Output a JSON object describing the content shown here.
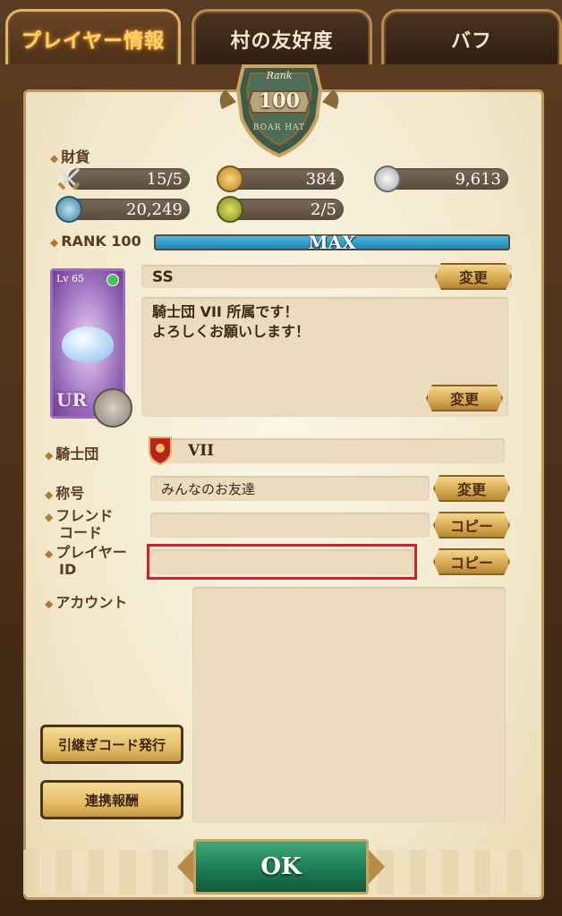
{
  "tabs": [
    {
      "label": "プレイヤー情報",
      "active": true
    },
    {
      "label": "村の友好度",
      "active": false
    },
    {
      "label": "バフ",
      "active": false
    }
  ],
  "rank_badge": {
    "label": "Rank",
    "value": "100",
    "subtitle": "BOAR HAT"
  },
  "currency": {
    "section_label": "財貨",
    "items": [
      {
        "icon": "swords-icon",
        "value": "15/5"
      },
      {
        "icon": "gold-coin-icon",
        "value": "384"
      },
      {
        "icon": "silver-coin-icon",
        "value": "9,613"
      },
      {
        "icon": "blue-gem-icon",
        "value": "20,249"
      },
      {
        "icon": "yellow-orb-icon",
        "value": "2/5"
      }
    ]
  },
  "rank": {
    "label": "RANK 100",
    "bar_text": "MAX",
    "progress": 1.0
  },
  "card": {
    "level": "Lv 65",
    "rarity": "UR"
  },
  "profile": {
    "name": "SS",
    "change_label": "変更",
    "comment_line1": "騎士団 VII 所属です！",
    "comment_line2": "よろしくお願いします！",
    "comment_change_label": "変更"
  },
  "knights": {
    "label": "騎士団",
    "value": "VII"
  },
  "title": {
    "label": "称号",
    "value": "みんなのお友達",
    "change_label": "変更"
  },
  "friend_code": {
    "label_line1": "フレンド",
    "label_line2": "コード",
    "value": "",
    "copy_label": "コピー"
  },
  "player_id": {
    "label_line1": "プレイヤー",
    "label_line2": "ID",
    "value": "",
    "copy_label": "コピー"
  },
  "account": {
    "label": "アカウント"
  },
  "buttons": {
    "transfer_code": "引継ぎコード発行",
    "link_reward": "連携報酬",
    "ok": "OK"
  }
}
